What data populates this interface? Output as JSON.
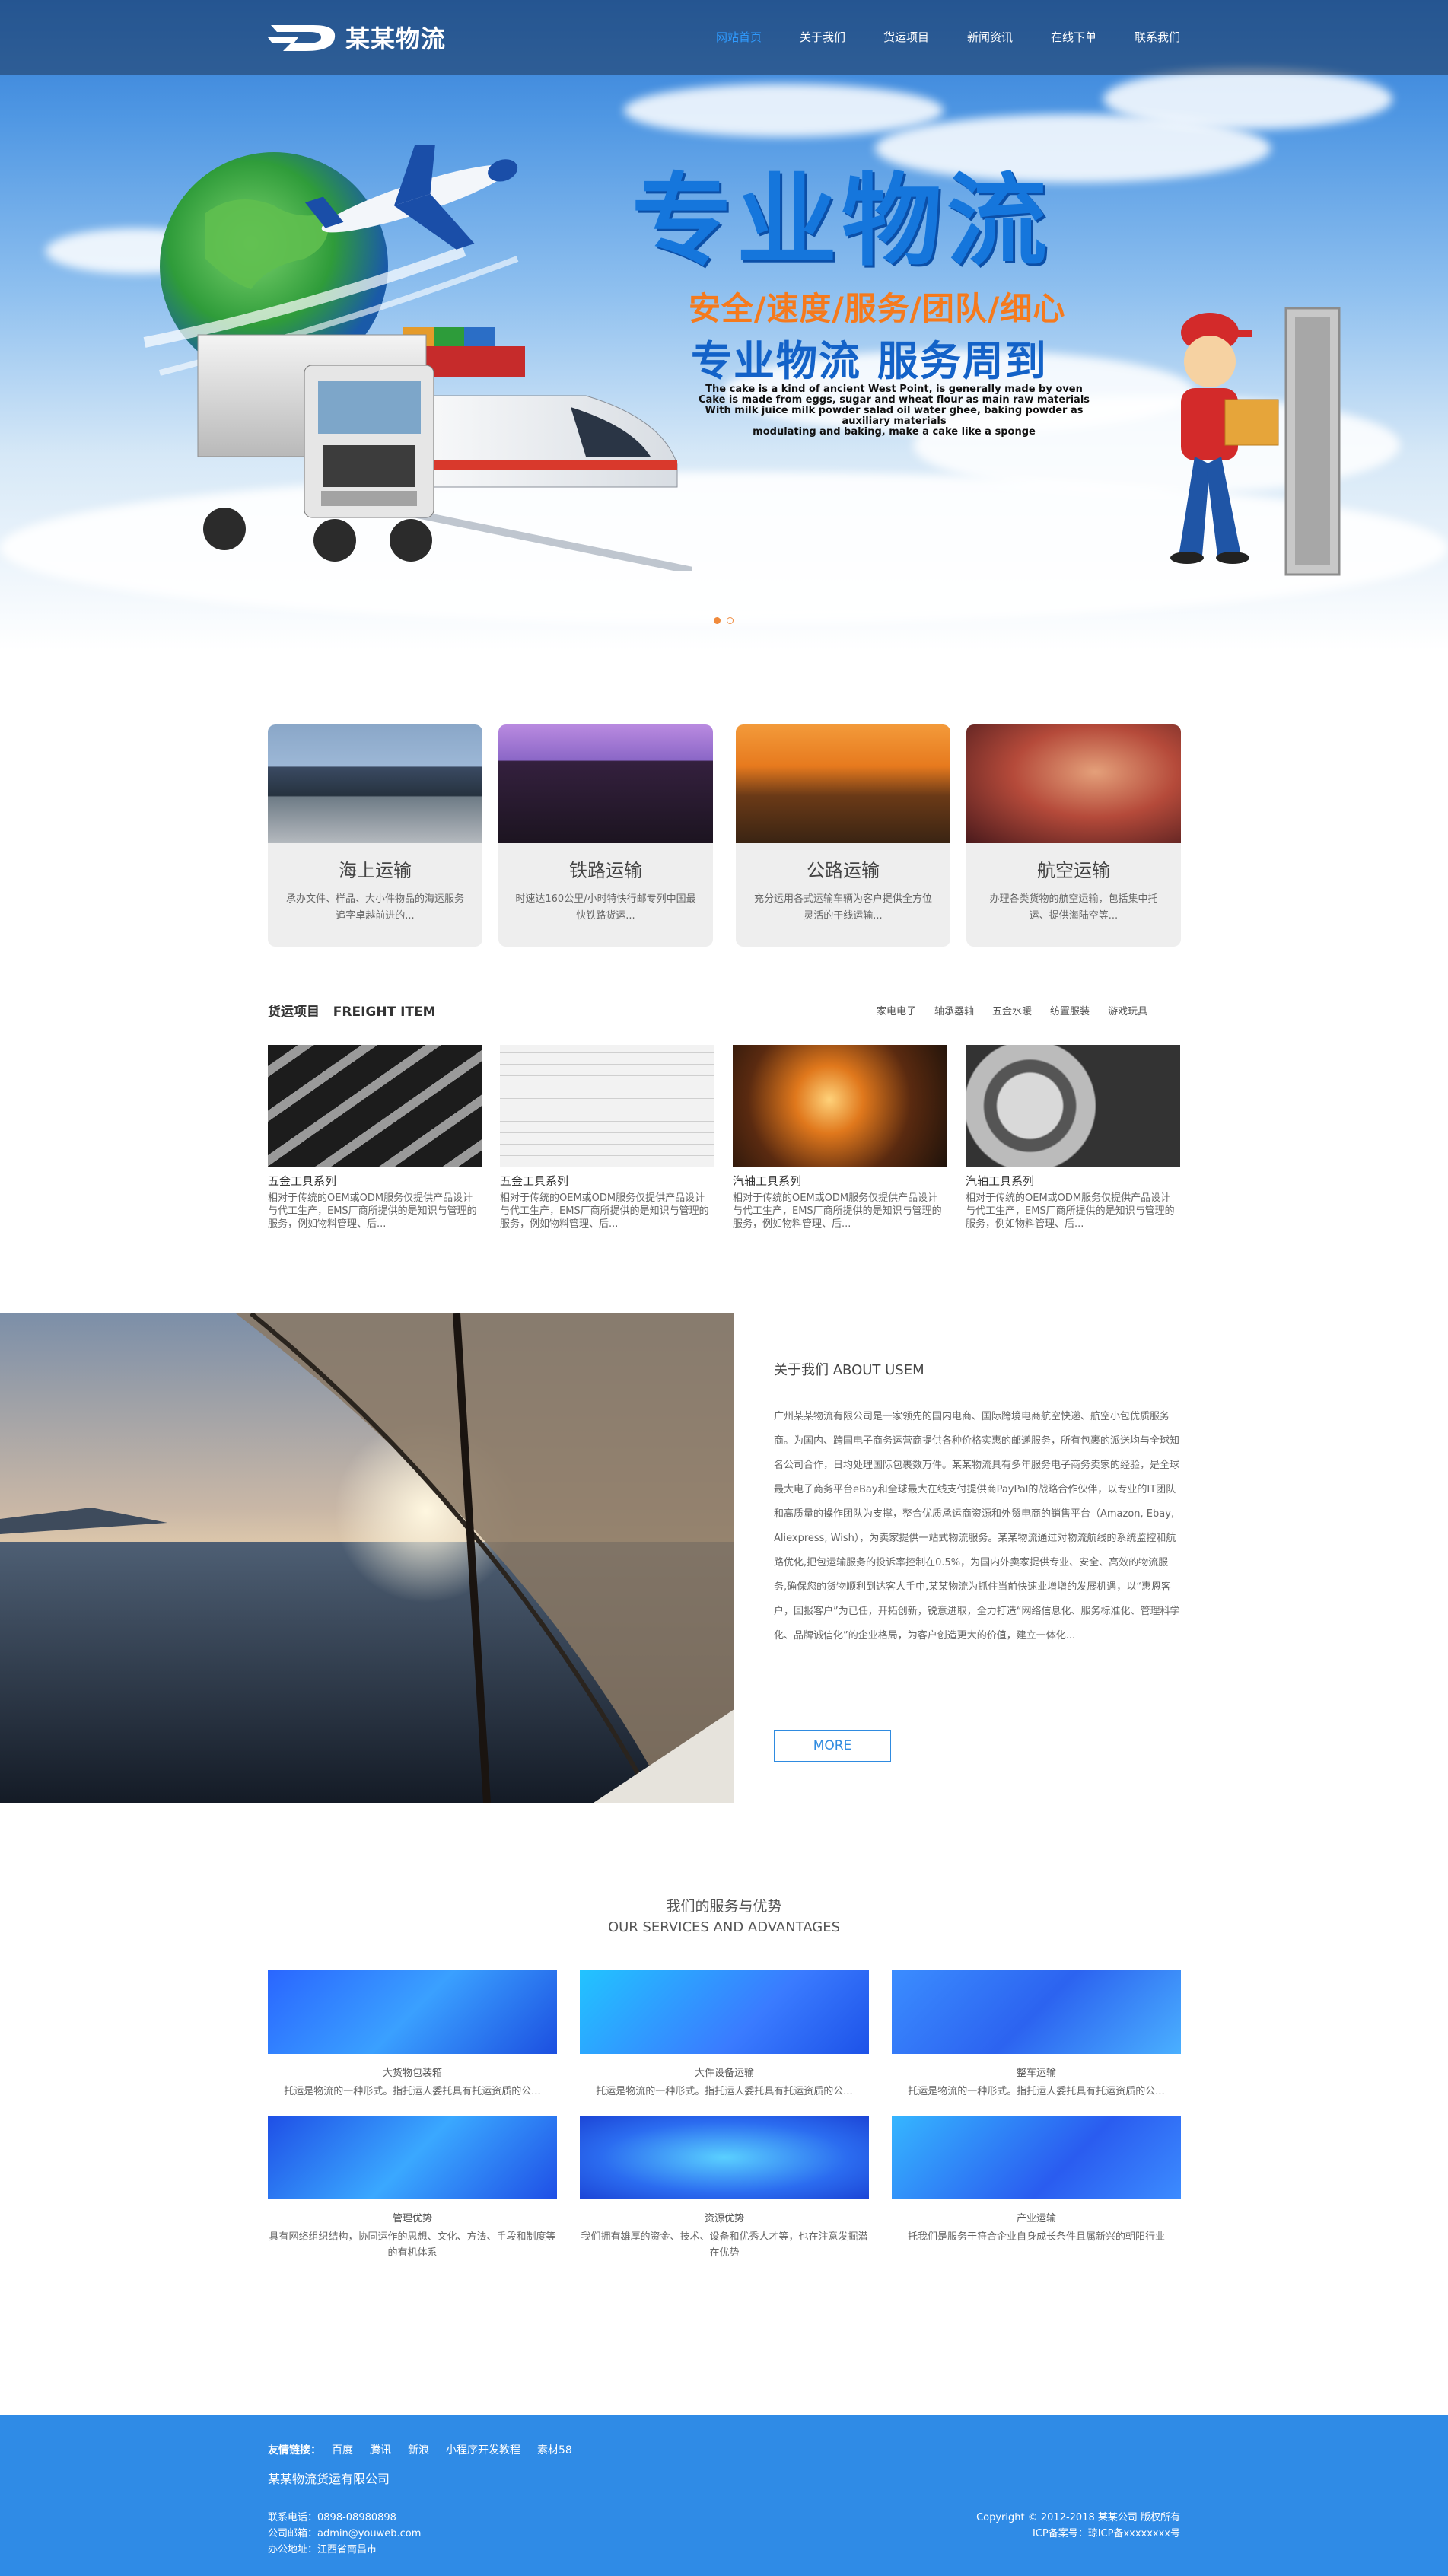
{
  "brand": {
    "name": "某某物流"
  },
  "nav": {
    "items": [
      {
        "label": "网站首页",
        "active": true
      },
      {
        "label": "关于我们"
      },
      {
        "label": "货运项目"
      },
      {
        "label": "新闻资讯"
      },
      {
        "label": "在线下单"
      },
      {
        "label": "联系我们"
      }
    ]
  },
  "hero": {
    "title": "专业物流",
    "sub1": "安全/速度/服务/团队/细心",
    "sub2": "专业物流 服务周到",
    "en_lines": [
      "The cake is a kind of ancient West Point, is generally made by oven",
      "Cake is made from eggs, sugar and wheat flour as main raw materials",
      "With milk  juice  milk  powder  salad  oil water  ghee, baking powder as auxiliary materials",
      "modulating and baking, make a cake like a sponge"
    ],
    "slides_total": 2,
    "slide_active": 1
  },
  "transport": [
    {
      "title": "海上运输",
      "desc": "承办文件、样品、大小件物品的海运服务追字卓越前进的..."
    },
    {
      "title": "铁路运输",
      "desc": "时速达160公里/小时特快行邮专列中国最快铁路货运..."
    },
    {
      "title": "公路运输",
      "desc": "充分运用各式运输车辆为客户提供全方位灵活的干线运输..."
    },
    {
      "title": "航空运输",
      "desc": "办理各类货物的航空运输，包括集中托运、提供海陆空等..."
    }
  ],
  "freight": {
    "title": "货运项目",
    "title_en": "FREIGHT ITEM",
    "categories": [
      "家电电子",
      "轴承器轴",
      "五金水暖",
      "纺置服装",
      "游戏玩具"
    ],
    "items": [
      {
        "title": "五金工具系列",
        "desc": "相对于传统的OEM或ODM服务仅提供产品设计与代工生产，EMS厂商所提供的是知识与管理的服务，例如物料管理、后..."
      },
      {
        "title": "五金工具系列",
        "desc": "相对于传统的OEM或ODM服务仅提供产品设计与代工生产，EMS厂商所提供的是知识与管理的服务，例如物料管理、后..."
      },
      {
        "title": "汽轴工具系列",
        "desc": "相对于传统的OEM或ODM服务仅提供产品设计与代工生产，EMS厂商所提供的是知识与管理的服务，例如物料管理、后..."
      },
      {
        "title": "汽轴工具系列",
        "desc": "相对于传统的OEM或ODM服务仅提供产品设计与代工生产，EMS厂商所提供的是知识与管理的服务，例如物料管理、后..."
      }
    ]
  },
  "about": {
    "title": "关于我们   ABOUT USEM",
    "text": "广州某某物流有限公司是一家领先的国内电商、国际跨境电商航空快递、航空小包优质服务商。为国内、跨国电子商务运营商提供各种价格实惠的邮递服务，所有包裹的派送均与全球知名公司合作，日均处理国际包裹数万件。某某物流具有多年服务电子商务卖家的经验，是全球最大电子商务平台eBay和全球最大在线支付提供商PayPal的战略合作伙伴，以专业的IT团队和高质量的操作团队为支撑，整合优质承运商资源和外贸电商的销售平台（Amazon, Ebay, Aliexpress, Wish），为卖家提供一站式物流服务。某某物流通过对物流航线的系统监控和航路优化,把包运输服务的投诉率控制在0.5%，为国内外卖家提供专业、安全、高效的物流服务,确保您的货物顺利到达客人手中,某某物流为抓住当前快速业增增的发展机遇，以“惠恩客户，回报客户”为已任，开拓创新，锐意进取，全力打造“网络信息化、服务标准化、管理科学化、品牌诚信化”的企业格局，为客户创造更大的价值，建立一体化...",
    "more": "MORE"
  },
  "services": {
    "title": "我们的服务与优势",
    "title_en": "OUR SERVICES AND ADVANTAGES",
    "items": [
      {
        "title": "大货物包装箱",
        "desc": "托运是物流的一种形式。指托运人委托具有托运资质的公..."
      },
      {
        "title": "大件设备运输",
        "desc": "托运是物流的一种形式。指托运人委托具有托运资质的公..."
      },
      {
        "title": "整车运输",
        "desc": "托运是物流的一种形式。指托运人委托具有托运资质的公..."
      },
      {
        "title": "管理优势",
        "desc": "具有网络组织结构，协同运作的思想、文化、方法、手段和制度等的有机体系"
      },
      {
        "title": "资源优势",
        "desc": "我们拥有雄厚的资金、技术、设备和优秀人才等，也在注意发掘潜在优势"
      },
      {
        "title": "产业运输",
        "desc": "托我们是服务于符合企业自身成长条件且属新兴的朝阳行业"
      }
    ]
  },
  "footer": {
    "links_label": "友情链接：",
    "links": [
      "百度",
      "腾讯",
      "新浪",
      "小程序开发教程",
      "素材58"
    ],
    "company": "某某物流货运有限公司",
    "phone": "联系电话：0898-08980898",
    "email": "公司邮箱：admin@youweb.com",
    "address": "办公地址：江西省南昌市",
    "copyright": "Copyright © 2012-2018 某某公司 版权所有",
    "icp": "ICP备案号：琼ICP备xxxxxxxx号"
  },
  "colors": {
    "accent": "#2f8be6",
    "nav_active": "#2f9bff",
    "hero_title": "#1576dc",
    "hero_orange": "#f57a1d"
  }
}
